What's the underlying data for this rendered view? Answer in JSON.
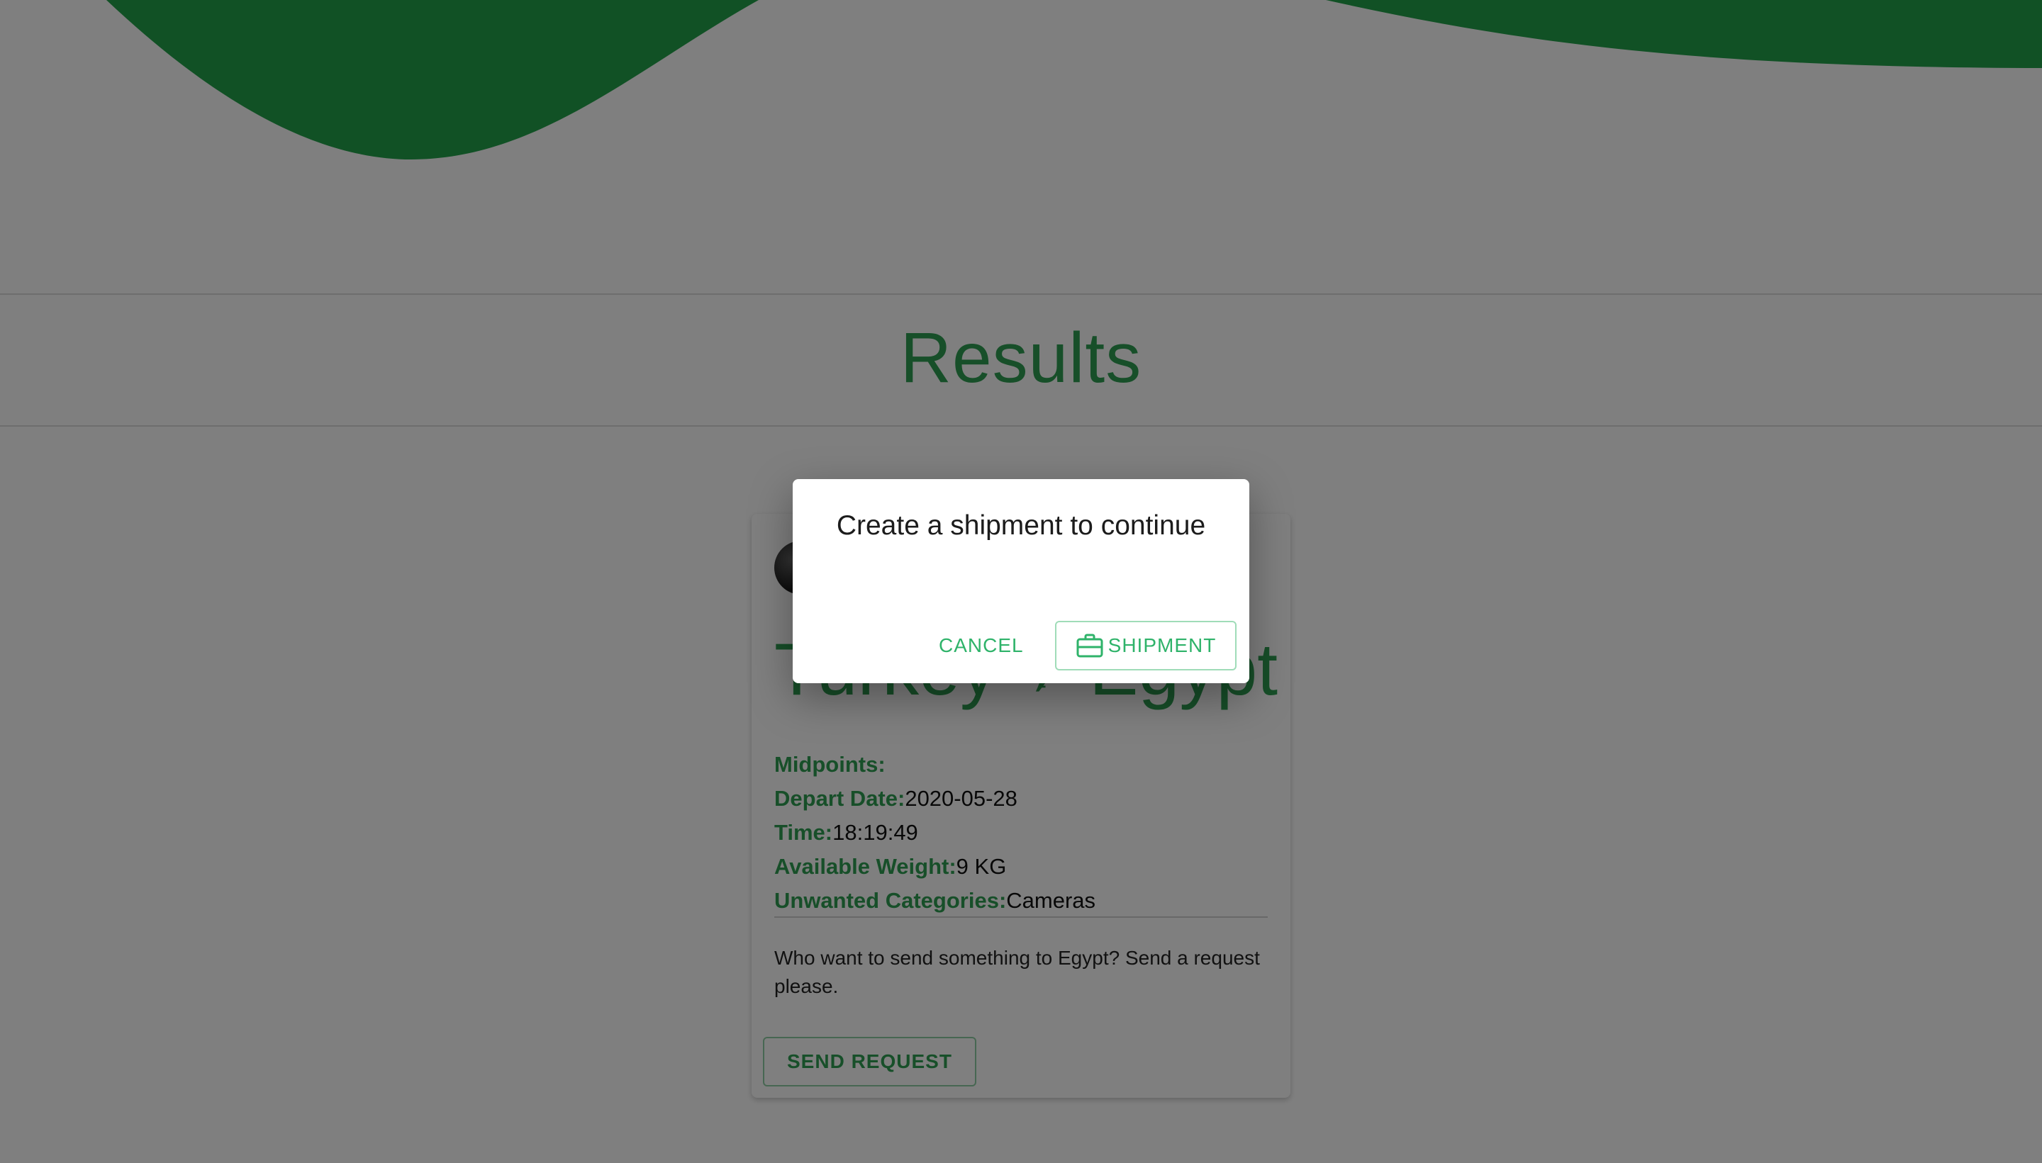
{
  "page": {
    "title": "Results",
    "accent_color": "#2f9e52",
    "wave_color": "#22a24b"
  },
  "card": {
    "origin": "Turkey",
    "destination": "Egypt",
    "route_icon": "airplane-icon",
    "details": [
      {
        "label": "Midpoints:",
        "value": ""
      },
      {
        "label": "Depart Date:",
        "value": "2020-05-28"
      },
      {
        "label": "Time:",
        "value": "18:19:49"
      },
      {
        "label": "Available Weight:",
        "value": "9 KG"
      },
      {
        "label": "Unwanted Categories:",
        "value": "Cameras"
      }
    ],
    "description": "Who want to send something to Egypt? Send a request please.",
    "send_request_label": "SEND REQUEST"
  },
  "dialog": {
    "title": "Create a shipment to continue",
    "cancel_label": "CANCEL",
    "shipment_label": "SHIPMENT",
    "shipment_icon": "briefcase-icon"
  }
}
